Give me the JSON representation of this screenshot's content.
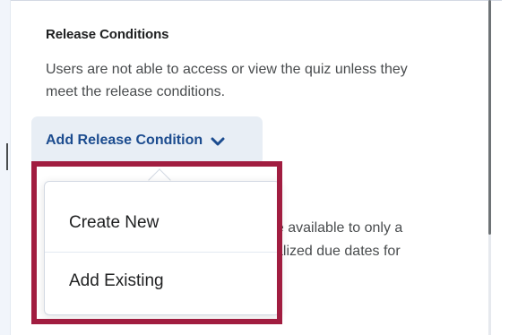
{
  "section": {
    "heading": "Release Conditions",
    "description": "Users are not able to access or view the quiz unless they meet the release conditions."
  },
  "add_button": {
    "label": "Add Release Condition",
    "icon": "chevron-down-icon"
  },
  "menu": {
    "items": [
      {
        "label": "Create New"
      },
      {
        "label": "Add Existing"
      }
    ]
  },
  "background": {
    "line1_partial": "be available to only a",
    "line2_partial": "alized due dates for"
  },
  "colors": {
    "accent": "#1c4c8f",
    "highlight": "#a11d40",
    "button_bg": "#e8eef5",
    "text": "#494c4e"
  }
}
